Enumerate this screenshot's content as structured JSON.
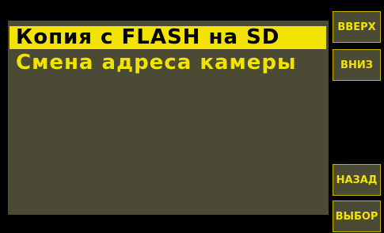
{
  "menu": {
    "items": [
      {
        "label": "Копия с FLASH на SD",
        "selected": true
      },
      {
        "label": "Смена адреса камеры",
        "selected": false
      }
    ]
  },
  "buttons": {
    "up": "ВВЕРХ",
    "down": "ВНИЗ",
    "back": "НАЗАД",
    "select": "ВЫБОР"
  },
  "colors": {
    "background": "#000000",
    "panel": "#4a4a35",
    "accent": "#f2e400"
  }
}
